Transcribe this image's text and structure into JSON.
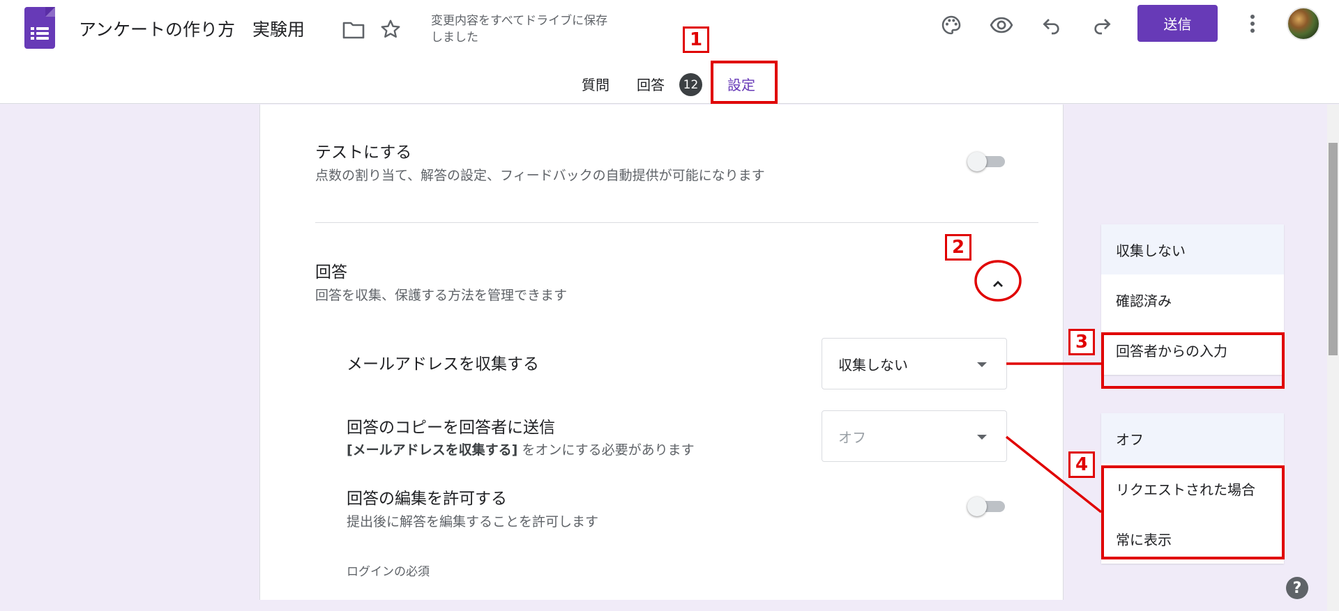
{
  "header": {
    "title": "アンケートの作り方　実験用",
    "save_status": "変更内容をすべてドライブに保存しました",
    "send_label": "送信",
    "icons": [
      "forms-logo-icon",
      "folder-icon",
      "star-icon",
      "palette-icon",
      "eye-icon",
      "undo-icon",
      "redo-icon",
      "more-vert-icon",
      "avatar"
    ],
    "accent_color": "#673ab7"
  },
  "tabs": {
    "questions": "質問",
    "responses": "回答",
    "responses_count": "12",
    "settings": "設定"
  },
  "settings": {
    "quiz": {
      "title": "テストにする",
      "desc": "点数の割り当て、解答の設定、フィードバックの自動提供が可能になります",
      "toggle_on": false
    },
    "responses": {
      "title": "回答",
      "desc": "回答を収集、保護する方法を管理できます",
      "expanded": true,
      "collect_email": {
        "label": "メールアドレスを収集する",
        "value": "収集しない"
      },
      "send_copy": {
        "label": "回答のコピーを回答者に送信",
        "desc_bold": "[メールアドレスを収集する]",
        "desc_rest": " をオンにする必要があります",
        "value": "オフ"
      },
      "allow_edit": {
        "label": "回答の編集を許可する",
        "desc": "提出後に解答を編集することを許可します",
        "toggle_on": false
      },
      "login_required_label": "ログインの必須"
    }
  },
  "menus": {
    "collect_email_options": [
      "収集しない",
      "確認済み",
      "回答者からの入力"
    ],
    "send_copy_options": [
      "オフ",
      "リクエストされた場合",
      "常に表示"
    ]
  },
  "annotations": {
    "labels": [
      "1",
      "2",
      "3",
      "4"
    ],
    "color": "#e00000"
  },
  "help_label": "?"
}
